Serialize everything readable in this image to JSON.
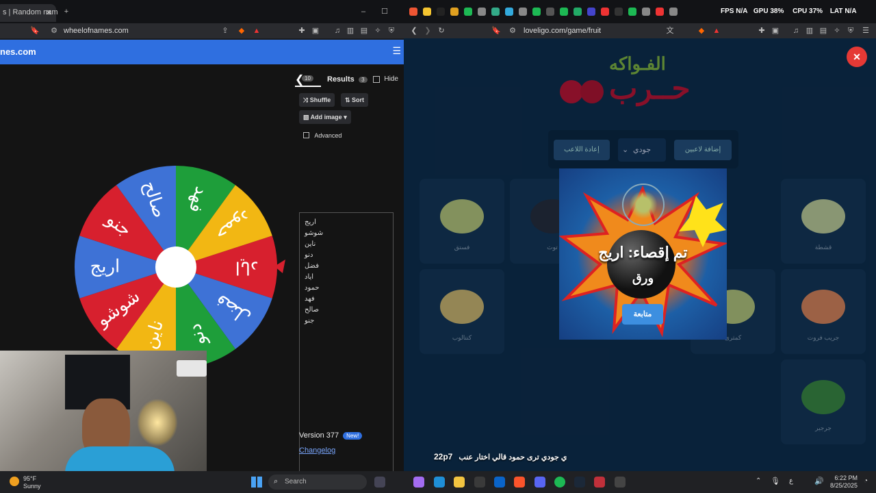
{
  "left_browser": {
    "tab_title": "s | Random nam",
    "url": "wheelofnames.com",
    "site_title": "nes.com",
    "tabs": {
      "entries_count": "10",
      "results_label": "Results",
      "results_count": "3",
      "hide_label": "Hide"
    },
    "buttons": {
      "shuffle": "Shuffle",
      "sort": "Sort",
      "add_image": "Add image",
      "advanced": "Advanced"
    },
    "names": [
      "اريج",
      "شوشو",
      "ناين",
      "دنو",
      "فضل",
      "اياد",
      "حمود",
      "فهد",
      "صالح",
      "جنو"
    ],
    "version": "Version 377",
    "new_badge": "New!",
    "changelog": "Changelog",
    "wheel_segments": [
      {
        "label": "اياد",
        "color": "#d7202e"
      },
      {
        "label": "فضل",
        "color": "#3e72d6"
      },
      {
        "label": "دنو",
        "color": "#1e9e3a"
      },
      {
        "label": "ناين",
        "color": "#f2b713"
      },
      {
        "label": "شوشو",
        "color": "#d7202e"
      },
      {
        "label": "اريج",
        "color": "#3e72d6"
      },
      {
        "label": "جنو",
        "color": "#d7202e"
      },
      {
        "label": "صالح",
        "color": "#3e72d6"
      },
      {
        "label": "فهد",
        "color": "#1e9e3a"
      },
      {
        "label": "حمود",
        "color": "#f2b713"
      }
    ]
  },
  "right_browser": {
    "url": "loveligo.com/game/fruit",
    "overlay_stats": {
      "fps_label": "FPS",
      "fps_value": "N/A",
      "gpu_label": "GPU",
      "gpu_value": "38%",
      "cpu_label": "CPU",
      "cpu_value": "37%",
      "lat_label": "LAT",
      "lat_value": "N/A"
    },
    "logo_top": "الفـواكه",
    "logo_bottom": "حــرب",
    "controls": {
      "add_players": "إضافة لاعبين",
      "dropdown_value": "جودي",
      "reset_player": "إعادة اللاعب"
    },
    "cards": [
      {
        "label": "قشطة"
      },
      {
        "label": "توت"
      },
      {
        "label": "فستق"
      },
      {
        "label": "جريب فروت"
      },
      {
        "label": "كمثرى"
      },
      {
        "label": "كنتالوب"
      },
      {
        "label": "جرجير"
      }
    ],
    "popup": {
      "message": "تم إقصاء: اريج",
      "fruit": "ورق",
      "continue": "متابعة"
    },
    "chat_line": "ي جودي ترى حمود قالي اختار عنب",
    "chat_user": "22p7"
  },
  "taskbar": {
    "temp": "95°F",
    "weather": "Sunny",
    "search_placeholder": "Search",
    "time": "6:22 PM",
    "date": "8/25/2025"
  },
  "colors": {
    "brand_blue": "#2f6fe0",
    "popup_button": "#3d8fe0",
    "close_red": "#e53935"
  }
}
